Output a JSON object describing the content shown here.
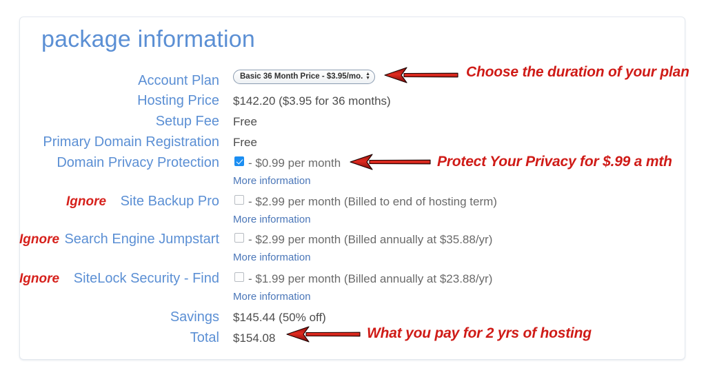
{
  "panel": {
    "title": "package information"
  },
  "colors": {
    "label_blue": "#5b8fd4",
    "link_blue": "#4a76b8",
    "annotation_red": "#cf1b17",
    "ignore_red": "#d6211c",
    "value_gray": "#4c4c4c",
    "checkbox_checked": "#1b8ef2",
    "panel_border": "#e4e9ef"
  },
  "rows": [
    {
      "key": "account_plan",
      "label": "Account Plan",
      "ignore": "",
      "value": "",
      "select_value": "Basic 36 Month Price - $3.95/mo.",
      "stepper_icon": "updown-stepper-icon",
      "more_information": ""
    },
    {
      "key": "hosting_price",
      "label": "Hosting Price",
      "ignore": "",
      "value": "$142.20  ($3.95 for 36 months)",
      "more_information": ""
    },
    {
      "key": "setup_fee",
      "label": "Setup Fee",
      "ignore": "",
      "value": "Free",
      "more_information": ""
    },
    {
      "key": "primary_domain_registration",
      "label": "Primary Domain Registration",
      "ignore": "",
      "value": "Free",
      "more_information": ""
    },
    {
      "key": "domain_privacy_protection",
      "label": "Domain Privacy Protection",
      "ignore": "",
      "checked": true,
      "value": "- $0.99 per month",
      "more_information": "More information"
    },
    {
      "key": "site_backup_pro",
      "label": "Site Backup Pro",
      "ignore": "Ignore",
      "checked": false,
      "value": "- $2.99 per month (Billed to end of hosting term)",
      "more_information": "More information"
    },
    {
      "key": "search_engine_jumpstart",
      "label": "Search Engine Jumpstart",
      "ignore": "Ignore",
      "checked": false,
      "value": "- $2.99 per month (Billed annually at $35.88/yr)",
      "more_information": "More information"
    },
    {
      "key": "sitelock_security_find",
      "label": "SiteLock Security - Find",
      "ignore": "Ignore",
      "checked": false,
      "value": "- $1.99 per month (Billed annually at $23.88/yr)",
      "more_information": "More information"
    },
    {
      "key": "savings",
      "label": "Savings",
      "ignore": "",
      "value": "$145.44 (50% off)",
      "more_information": ""
    },
    {
      "key": "total",
      "label": "Total",
      "ignore": "",
      "value": "$154.08",
      "more_information": ""
    }
  ],
  "annotations": [
    {
      "key": "plan_duration",
      "text": "Choose the duration of your plan",
      "arrow_icon": "left-arrow-icon"
    },
    {
      "key": "privacy_protection",
      "text": "Protect Your Privacy for $.99 a mth",
      "arrow_icon": "left-arrow-icon"
    },
    {
      "key": "total_cost",
      "text": "What you pay for 2 yrs of hosting",
      "arrow_icon": "left-arrow-icon"
    }
  ]
}
